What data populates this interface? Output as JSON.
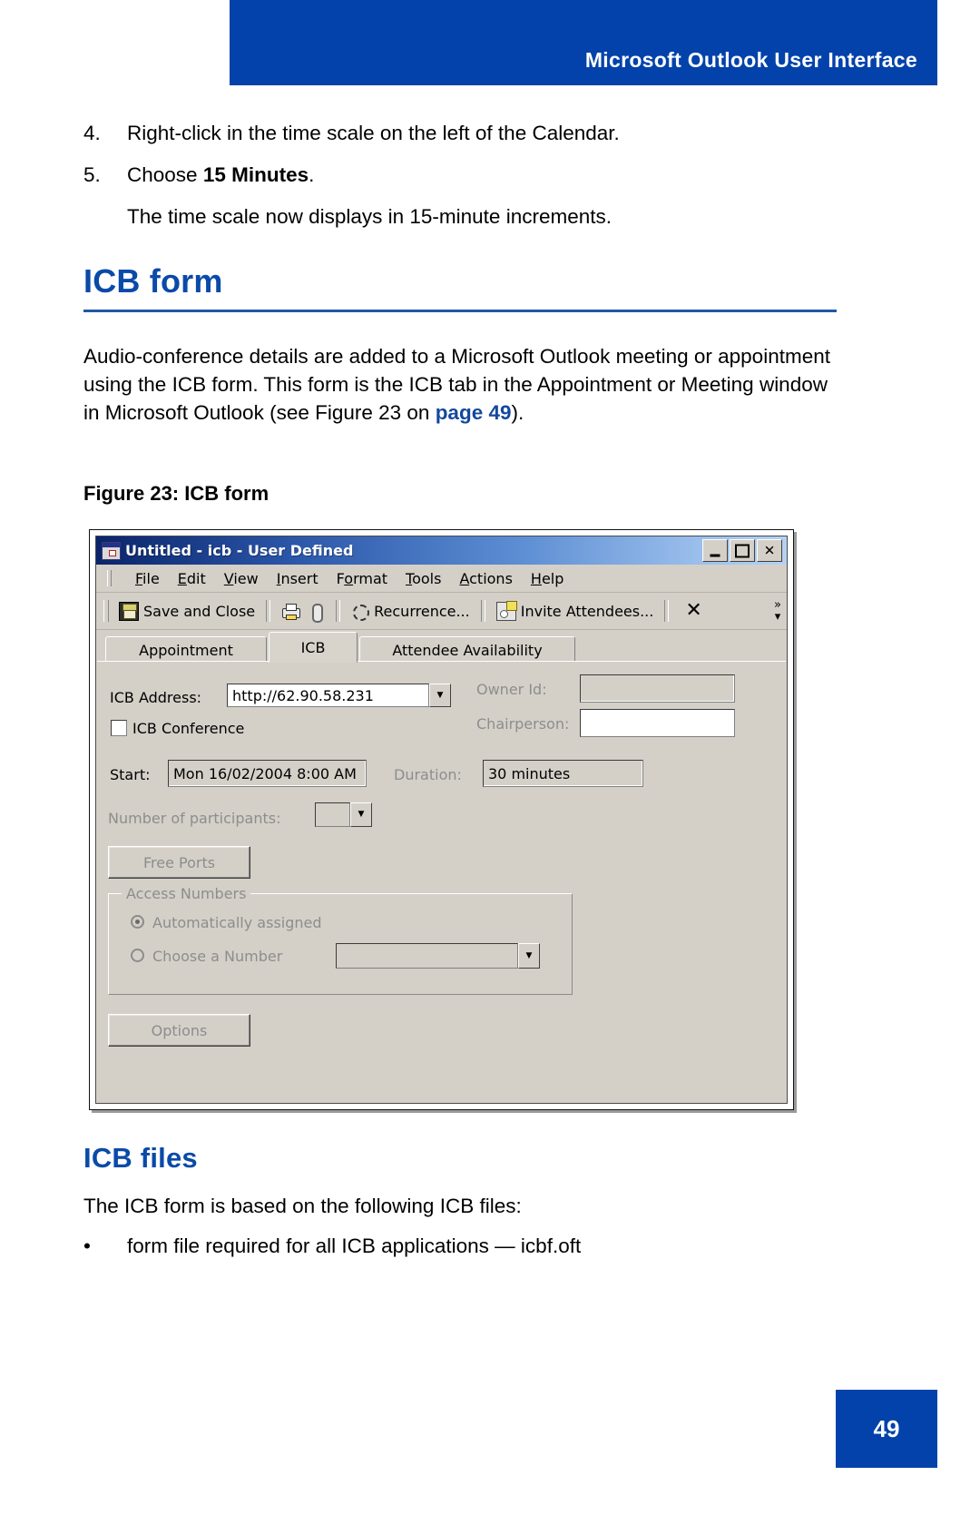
{
  "page": {
    "header_title": "Microsoft Outlook User Interface",
    "page_number": "49",
    "accent_blue": "#0342aa",
    "link_blue": "#14489e"
  },
  "steps": [
    {
      "num": "4.",
      "text": "Right-click in the time scale on the left of the Calendar."
    },
    {
      "num": "5.",
      "text_before": "Choose ",
      "text_bold": "15 Minutes",
      "text_after": "."
    }
  ],
  "step_result": "The time scale now displays in 15-minute increments.",
  "sections": {
    "icb_form": {
      "heading": "ICB form",
      "paragraph_1": "Audio-conference details are added to a Microsoft Outlook meeting or appointment using the ICB form. This form is the ICB tab in the Appointment or Meeting window in Microsoft Outlook (see Figure 23 on ",
      "link_text": "page 49",
      "paragraph_2": ").",
      "figure_caption": "Figure 23: ICB form"
    },
    "icb_files": {
      "heading": "ICB files",
      "intro": "The ICB form is based on the following ICB files:",
      "bullet_symbol": "•",
      "bullet_text": "form file required for all ICB applications — icbf.oft"
    }
  },
  "dialog": {
    "title": "Untitled - icb  - User Defined",
    "window_buttons": {
      "minimize": "minimize",
      "maximize": "maximize",
      "close": "✕"
    },
    "menu": [
      "File",
      "Edit",
      "View",
      "Insert",
      "Format",
      "Tools",
      "Actions",
      "Help"
    ],
    "menu_mnemonics": [
      "F",
      "E",
      "V",
      "I",
      "F",
      "T",
      "A",
      "H"
    ],
    "toolbar": {
      "save_and_close": "Save and Close",
      "print": "print-icon",
      "attach": "paperclip-icon",
      "recurrence": "Recurrence...",
      "invite_attendees": "Invite Attendees...",
      "delete": "✕",
      "overflow": "»"
    },
    "tabs": [
      {
        "label": "Appointment",
        "active": false
      },
      {
        "label": "ICB",
        "active": true
      },
      {
        "label": "Attendee Availability",
        "active": false
      }
    ],
    "form": {
      "icb_address_label": "ICB Address:",
      "icb_address_value": "http://62.90.58.231",
      "icb_conference_label": "ICB Conference",
      "icb_conference_checked": false,
      "owner_id_label": "Owner Id:",
      "owner_id_value": "",
      "chairperson_label": "Chairperson:",
      "chairperson_value": "",
      "start_label": "Start:",
      "start_value": "Mon 16/02/2004 8:00 AM",
      "duration_label": "Duration:",
      "duration_value": "30 minutes",
      "participants_label": "Number of participants:",
      "participants_value": "",
      "free_ports_button": "Free Ports",
      "access_numbers_group": "Access Numbers",
      "auto_assigned_label": "Automatically assigned",
      "auto_assigned_selected": true,
      "choose_number_label": "Choose a Number",
      "choose_number_selected": false,
      "choose_number_value": "",
      "options_button": "Options"
    }
  }
}
